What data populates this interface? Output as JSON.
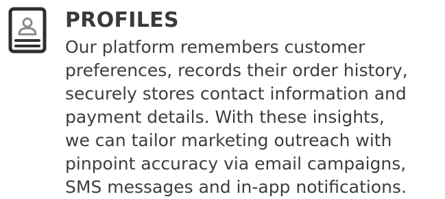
{
  "feature": {
    "icon": "profile-card-icon",
    "title": "PROFILES",
    "body_lines": [
      "Our platform remembers customer",
      "preferences, records their order history,",
      "securely stores contact information and",
      "payment details. With these insights,",
      "we can tailor marketing outreach with",
      "pinpoint accuracy via email campaigns,",
      "SMS messages and in-app notifications."
    ]
  },
  "colors": {
    "text": "#3a3a3a",
    "icon_stroke": "#2f2f2f",
    "background": "#ffffff"
  }
}
